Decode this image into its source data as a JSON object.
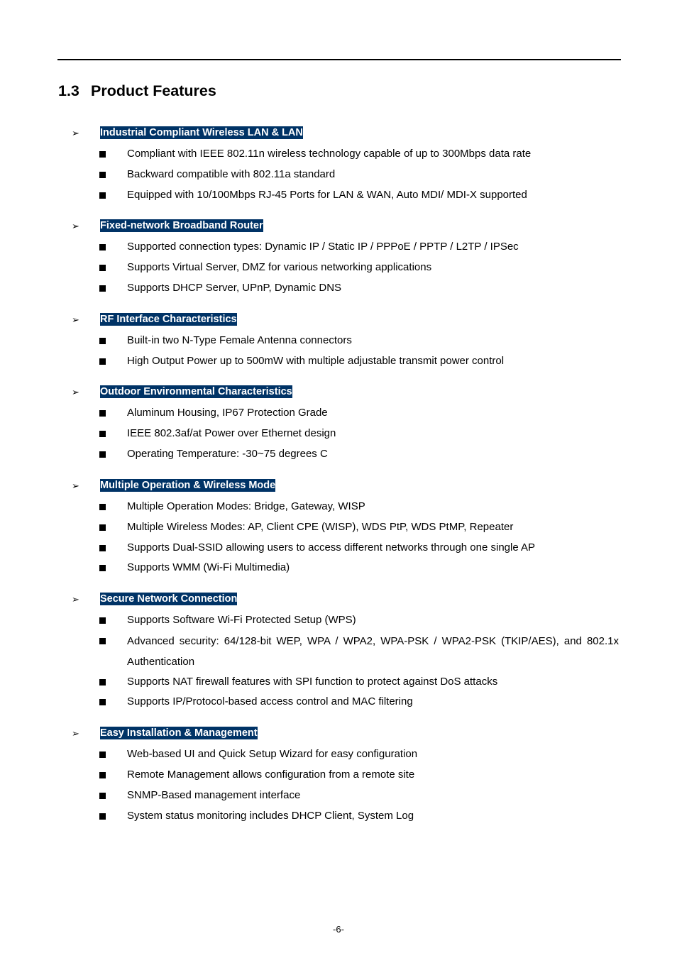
{
  "heading": {
    "number": "1.3",
    "title": "Product Features"
  },
  "sections": [
    {
      "label": "Industrial Compliant Wireless LAN & LAN",
      "items": [
        "Compliant with IEEE 802.11n wireless technology capable of up to 300Mbps data rate",
        "Backward compatible with 802.11a standard",
        "Equipped with 10/100Mbps RJ-45 Ports for LAN & WAN, Auto MDI/ MDI-X supported"
      ]
    },
    {
      "label": "Fixed-network Broadband Router",
      "items": [
        "Supported connection types: Dynamic IP / Static IP / PPPoE / PPTP / L2TP / IPSec",
        "Supports Virtual Server, DMZ for various networking applications",
        "Supports DHCP Server, UPnP, Dynamic DNS"
      ]
    },
    {
      "label": "RF Interface Characteristics",
      "items": [
        "Built-in two N-Type Female Antenna connectors",
        "High Output Power up to 500mW with multiple adjustable transmit power control"
      ]
    },
    {
      "label": "Outdoor Environmental Characteristics",
      "items": [
        "Aluminum Housing, IP67 Protection Grade",
        "IEEE 802.3af/at Power over Ethernet design",
        "Operating Temperature: -30~75 degrees C"
      ]
    },
    {
      "label": "Multiple Operation & Wireless Mode",
      "items": [
        "Multiple Operation Modes: Bridge, Gateway, WISP",
        "Multiple Wireless Modes: AP, Client CPE (WISP), WDS PtP, WDS PtMP, Repeater",
        "Supports Dual-SSID allowing users to access different networks through one single AP",
        "Supports WMM (Wi-Fi Multimedia)"
      ]
    },
    {
      "label": "Secure Network Connection",
      "items": [
        "Supports Software Wi-Fi Protected Setup (WPS)",
        "Advanced security: 64/128-bit WEP, WPA / WPA2, WPA-PSK / WPA2-PSK (TKIP/AES), and 802.1x Authentication",
        "Supports NAT firewall features with SPI function to protect against DoS attacks",
        "Supports IP/Protocol-based access control and MAC filtering"
      ]
    },
    {
      "label": "Easy Installation & Management",
      "items": [
        "Web-based UI and Quick Setup Wizard for easy configuration",
        "Remote Management allows configuration from a remote site",
        "SNMP-Based management interface",
        "System status monitoring includes DHCP Client, System Log"
      ]
    }
  ],
  "footer": {
    "page_number": "-6-"
  }
}
